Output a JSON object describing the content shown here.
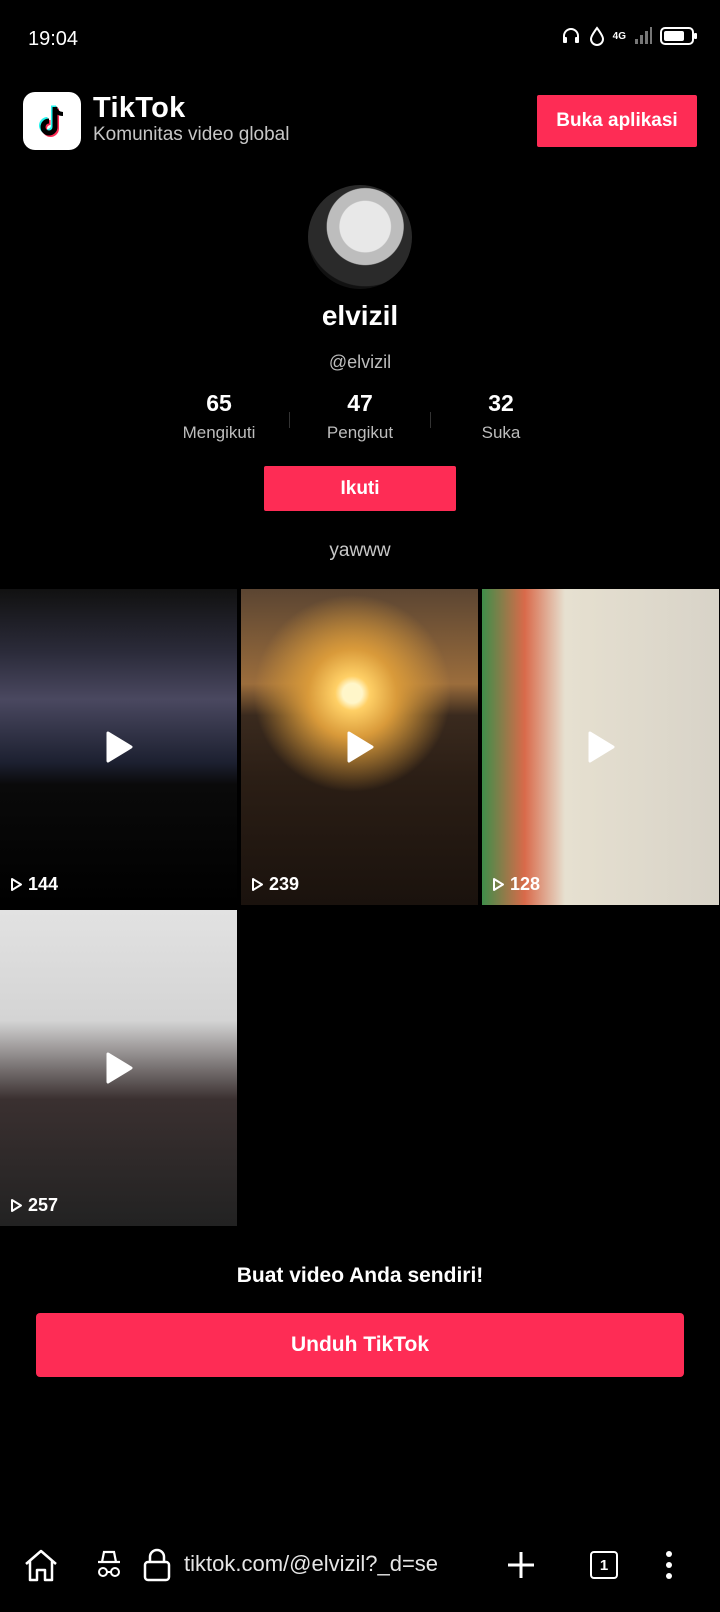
{
  "status_bar": {
    "time": "19:04",
    "network": "4G"
  },
  "header": {
    "app_name": "TikTok",
    "tagline": "Komunitas video global",
    "open_app_label": "Buka aplikasi"
  },
  "profile": {
    "display_name": "elvizil",
    "handle": "@elvizil",
    "stats": [
      {
        "value": "65",
        "label": "Mengikuti"
      },
      {
        "value": "47",
        "label": "Pengikut"
      },
      {
        "value": "32",
        "label": "Suka"
      }
    ],
    "follow_label": "Ikuti",
    "bio": "yawww"
  },
  "videos": [
    {
      "views": "144"
    },
    {
      "views": "239"
    },
    {
      "views": "128"
    },
    {
      "views": "257"
    }
  ],
  "cta": {
    "text": "Buat video Anda sendiri!",
    "download_label": "Unduh TikTok"
  },
  "browser": {
    "url": "tiktok.com/@elvizil?_d=se",
    "tab_count": "1"
  },
  "colors": {
    "accent": "#fe2c55",
    "background": "#000000"
  }
}
